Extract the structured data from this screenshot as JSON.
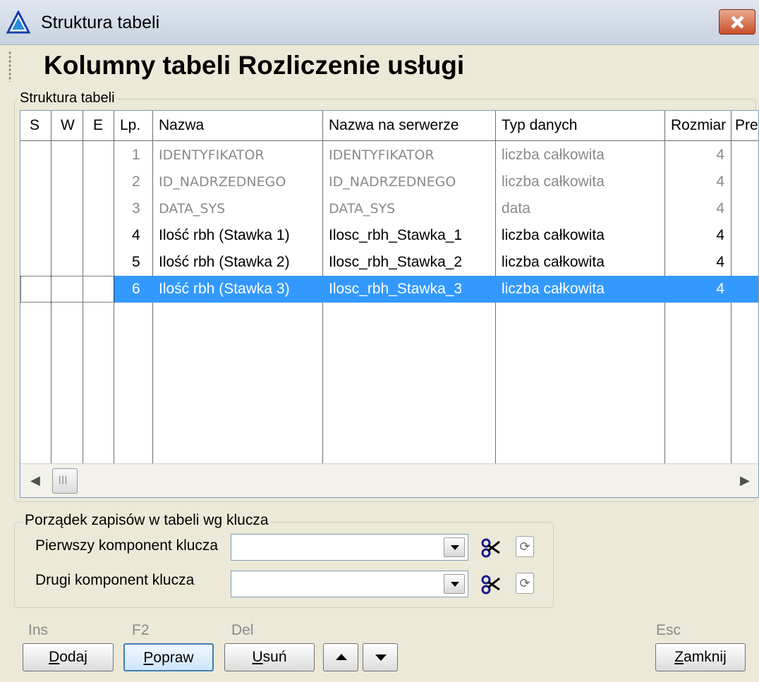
{
  "window": {
    "title": "Struktura tabeli",
    "heading": "Kolumny tabeli Rozliczenie usługi"
  },
  "structure": {
    "group_label": "Struktura tabeli",
    "columns": [
      "S",
      "W",
      "E",
      "Lp.",
      "Nazwa",
      "Nazwa na serwerze",
      "Typ danych",
      "Rozmiar",
      "Pre"
    ],
    "rows": [
      {
        "lp": "1",
        "nazwa": "IDENTYFIKATOR",
        "serwer": "IDENTYFIKATOR",
        "typ": "liczba całkowita",
        "rozmiar": "4"
      },
      {
        "lp": "2",
        "nazwa": "ID_NADRZEDNEGO",
        "serwer": "ID_NADRZEDNEGO",
        "typ": "liczba całkowita",
        "rozmiar": "4"
      },
      {
        "lp": "3",
        "nazwa": "DATA_SYS",
        "serwer": "DATA_SYS",
        "typ": "data",
        "rozmiar": "4"
      },
      {
        "lp": "4",
        "nazwa": "Ilość rbh (Stawka 1)",
        "serwer": "Ilosc_rbh_Stawka_1",
        "typ": "liczba całkowita",
        "rozmiar": "4"
      },
      {
        "lp": "5",
        "nazwa": "Ilość rbh (Stawka 2)",
        "serwer": "Ilosc_rbh_Stawka_2",
        "typ": "liczba całkowita",
        "rozmiar": "4"
      },
      {
        "lp": "6",
        "nazwa": "Ilość rbh (Stawka 3)",
        "serwer": "Ilosc_rbh_Stawka_3",
        "typ": "liczba całkowita",
        "rozmiar": "4"
      }
    ]
  },
  "key": {
    "group_label": "Porządek zapisów w tabeli wg klucza",
    "first_label": "Pierwszy komponent klucza",
    "second_label": "Drugi komponent klucza",
    "first_value": "",
    "second_value": ""
  },
  "buttons": {
    "add": {
      "hotkey": "Ins",
      "label_u": "D",
      "label_rest": "odaj"
    },
    "edit": {
      "hotkey": "F2",
      "label_u": "P",
      "label_rest": "opraw"
    },
    "delete": {
      "hotkey": "Del",
      "label_u": "U",
      "label_rest": "suń"
    },
    "close": {
      "hotkey": "Esc",
      "label_u": "Z",
      "label_rest": "amknij"
    }
  },
  "icons": {
    "app": "warning-triangle-icon",
    "close": "close-icon",
    "cut": "scissors-icon",
    "refresh": "refresh-icon",
    "up": "arrow-up-icon",
    "down": "arrow-down-icon"
  },
  "colors": {
    "selection": "#3399ff",
    "close_button": "#c9502c"
  }
}
